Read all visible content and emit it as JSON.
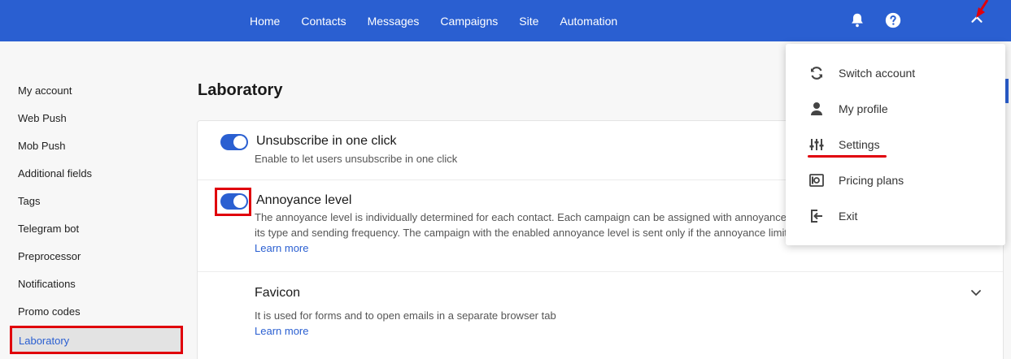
{
  "nav": {
    "items": [
      {
        "label": "Home"
      },
      {
        "label": "Contacts"
      },
      {
        "label": "Messages"
      },
      {
        "label": "Campaigns"
      },
      {
        "label": "Site"
      },
      {
        "label": "Automation"
      }
    ],
    "icons": [
      "bell-icon",
      "help-icon",
      "chevron-up-icon"
    ]
  },
  "sidebar": {
    "items": [
      {
        "label": "My account"
      },
      {
        "label": "Web Push"
      },
      {
        "label": "Mob Push"
      },
      {
        "label": "Additional fields"
      },
      {
        "label": "Tags"
      },
      {
        "label": "Telegram bot"
      },
      {
        "label": "Preprocessor"
      },
      {
        "label": "Notifications"
      },
      {
        "label": "Promo codes"
      },
      {
        "label": "Laboratory"
      }
    ],
    "active": "Laboratory"
  },
  "main": {
    "title": "Laboratory",
    "options": [
      {
        "title": "Unsubscribe in one click",
        "description": "Enable to let users unsubscribe in one click",
        "enabled": true
      },
      {
        "title": "Annoyance level",
        "description_line1": "The annoyance level is individually determined for each contact. Each campaign can be assigned with annoyance",
        "description_line2": "its type and sending frequency. The campaign with the enabled annoyance level is sent only if the annoyance limit",
        "link": "Learn more",
        "enabled": true
      },
      {
        "title": "Favicon",
        "description": "It is used for forms and to open emails in a separate browser tab",
        "link": "Learn more"
      }
    ]
  },
  "menu": {
    "items": [
      {
        "label": "Switch account",
        "icon": "refresh-icon"
      },
      {
        "label": "My profile",
        "icon": "person-icon"
      },
      {
        "label": "Settings",
        "icon": "sliders-icon"
      },
      {
        "label": "Pricing plans",
        "icon": "money-icon"
      },
      {
        "label": "Exit",
        "icon": "exit-icon"
      }
    ]
  },
  "colors": {
    "brand": "#2a5fd1",
    "highlight": "#e0000b"
  }
}
